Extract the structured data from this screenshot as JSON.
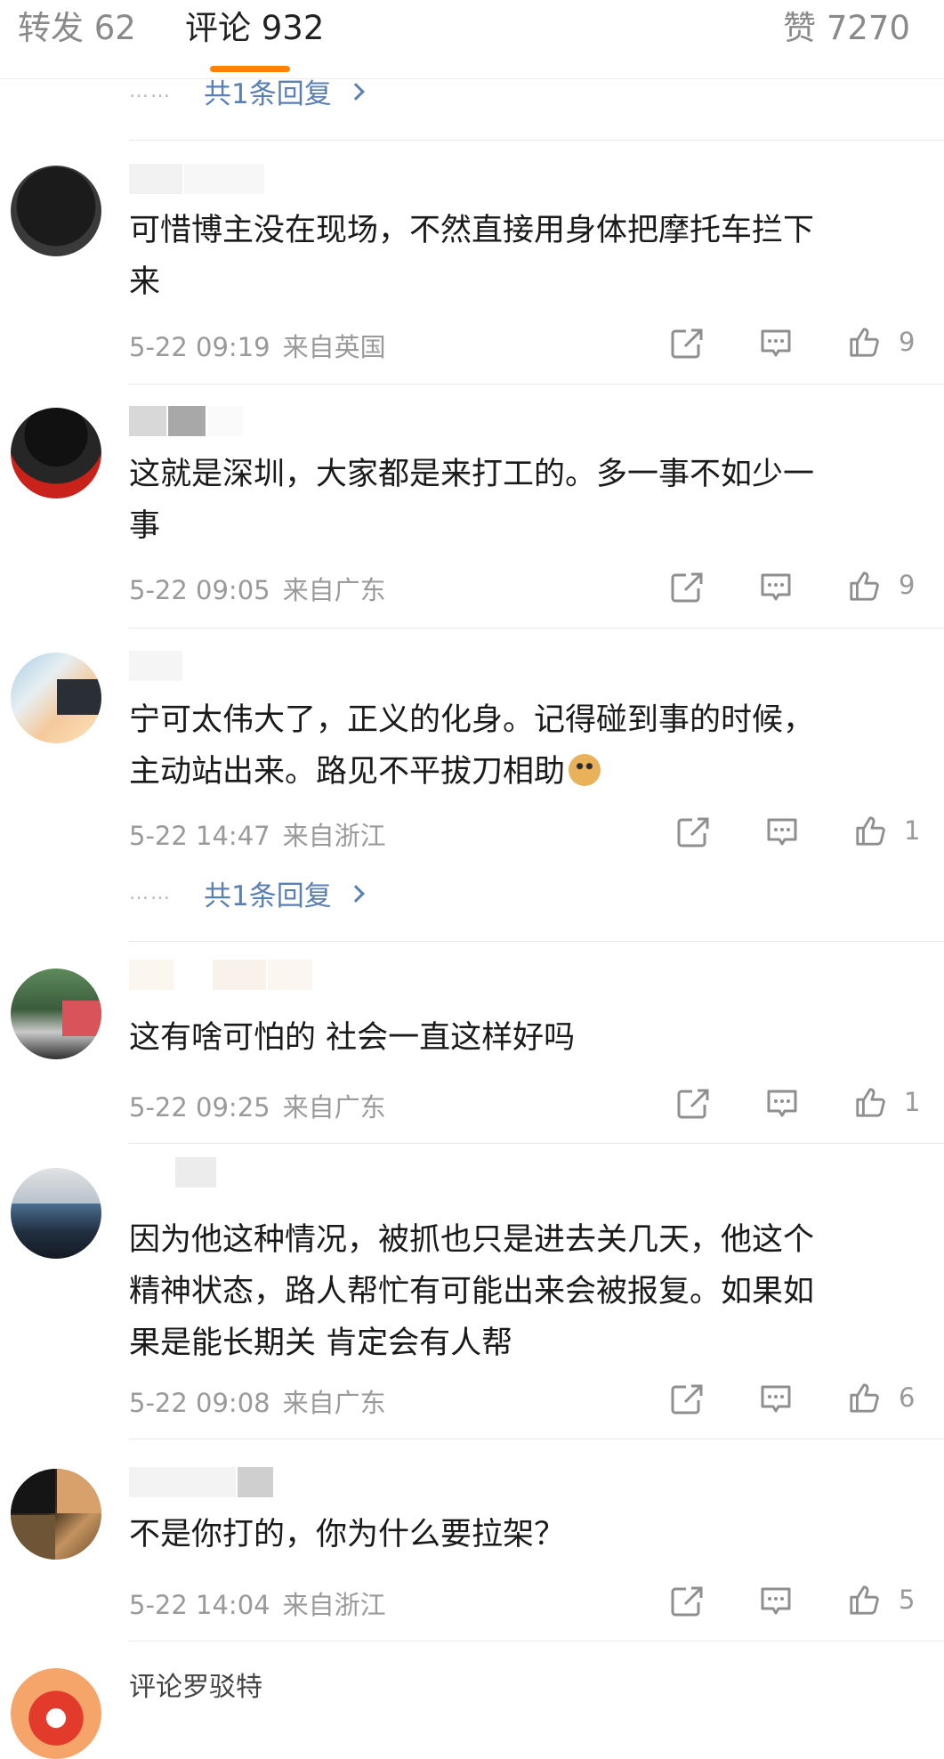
{
  "tabs": {
    "repost": "转发 62",
    "comment": "评论 932",
    "like": "赞 7270"
  },
  "reply_link_top": {
    "dots": "……",
    "text": "共1条回复"
  },
  "comments": [
    {
      "content": "可惜博主没在现场，不然直接用身体把摩托车拦下来",
      "line1": "可惜博主没在现场，不然直接用身体把摩托车拦下",
      "line2": "来",
      "time": "5-22 09:19",
      "location": "来自英国",
      "likes": "9"
    },
    {
      "content": "这就是深圳，大家都是来打工的。多一事不如少一事",
      "line1": "这就是深圳，大家都是来打工的。多一事不如少一",
      "line2": "事",
      "time": "5-22 09:05",
      "location": "来自广东",
      "likes": "9"
    },
    {
      "line1": "宁可太伟大了，正义的化身。记得碰到事的时候，",
      "line2": "主动站出来。路见不平拔刀相助",
      "emoji": "doge-emoji",
      "time": "5-22 14:47",
      "location": "来自浙江",
      "likes": "1",
      "reply": {
        "dots": "……",
        "text": "共1条回复"
      }
    },
    {
      "line1": "这有啥可怕的 社会一直这样好吗",
      "time": "5-22 09:25",
      "location": "来自广东",
      "likes": "1"
    },
    {
      "line1": "因为他这种情况，被抓也只是进去关几天，他这个",
      "line2": "精神状态，路人帮忙有可能出来会被报复。如果如",
      "line3": "果是能长期关 肯定会有人帮",
      "time": "5-22 09:08",
      "location": "来自广东",
      "likes": "6"
    },
    {
      "line1": "不是你打的，你为什么要拉架？",
      "time": "5-22 14:04",
      "location": "来自浙江",
      "likes": "5"
    },
    {
      "username": "评论罗驳特"
    }
  ],
  "colors": {
    "accent_underline": "#ff8200",
    "link_blue": "#5a7fb4",
    "meta_gray": "#9a9a9a"
  },
  "icons": [
    "share-icon",
    "comment-icon",
    "thumbs-up-icon",
    "chevron-right-icon"
  ]
}
